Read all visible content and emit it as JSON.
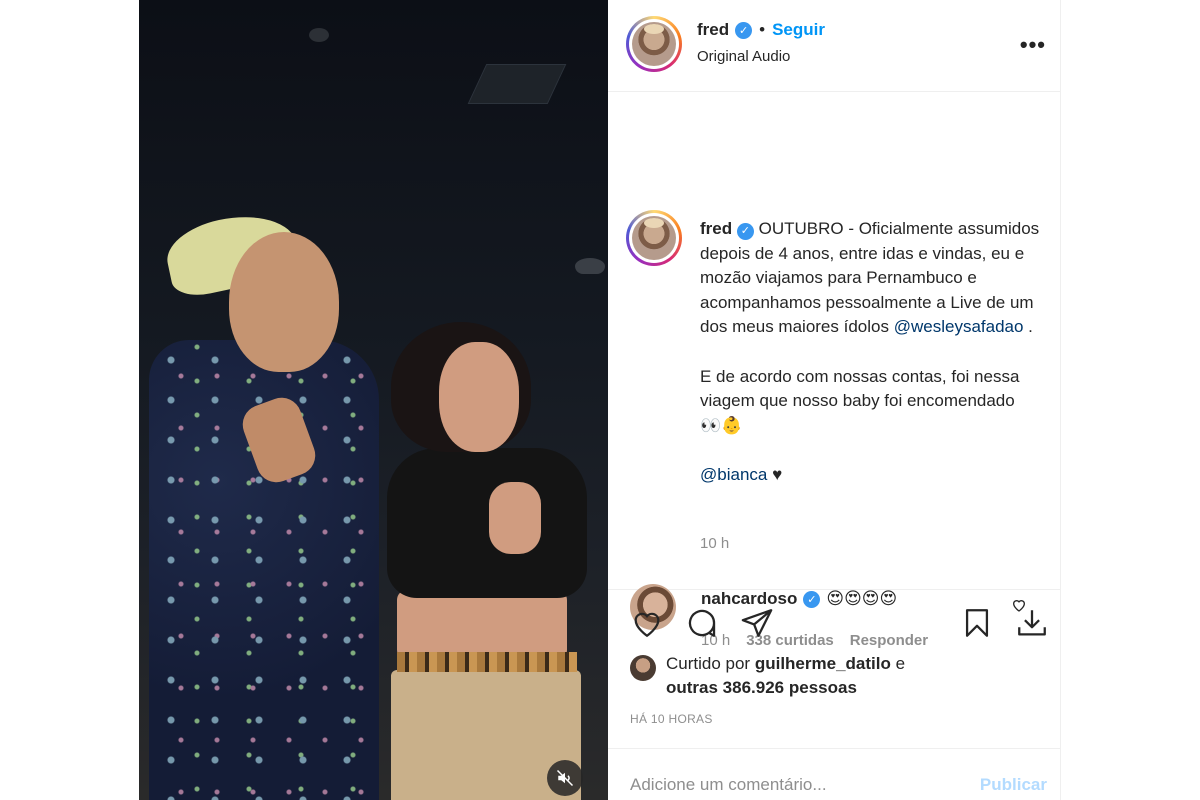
{
  "post": {
    "author": "fred",
    "follow_label": "Seguir",
    "separator": "•",
    "audio_label": "Original Audio",
    "more_label": "•••"
  },
  "caption": {
    "author": "fred",
    "paragraph1": "OUTUBRO - Oficialmente assumidos depois de 4 anos, entre idas e vindas, eu e mozão viajamos para Pernambuco e acompanhamos pessoalmente a Live de um dos meus maiores ídolos",
    "mention1": "@wesleysafadao",
    "paragraph1_end": " .",
    "paragraph2": "E de acordo com nossas contas, foi nessa viagem que nosso baby foi encomendado 👀👶",
    "mention2": "@bianca",
    "paragraph3_end": " ♥",
    "time": "10 h"
  },
  "comment": {
    "author": "nahcardoso",
    "text": "😍😍😍😍",
    "time": "10 h",
    "likes": "338 curtidas",
    "reply_label": "Responder"
  },
  "likes": {
    "prefix": "Curtido por ",
    "user": "guilherme_datilo",
    "middle": " e",
    "others": "outras 386.926 pessoas"
  },
  "age": "HÁ 10 HORAS",
  "input": {
    "placeholder": "Adicione um comentário...",
    "publish_label": "Publicar"
  },
  "colors": {
    "link": "#0095f6",
    "mention": "#00376b",
    "muted": "#8e8e8e",
    "verified": "#3897f0",
    "publish_disabled": "#b3dbff"
  },
  "icons": [
    "heart-icon",
    "comment-icon",
    "share-icon",
    "bookmark-icon",
    "download-icon",
    "mute-icon",
    "verified-badge-icon",
    "more-options-icon"
  ]
}
